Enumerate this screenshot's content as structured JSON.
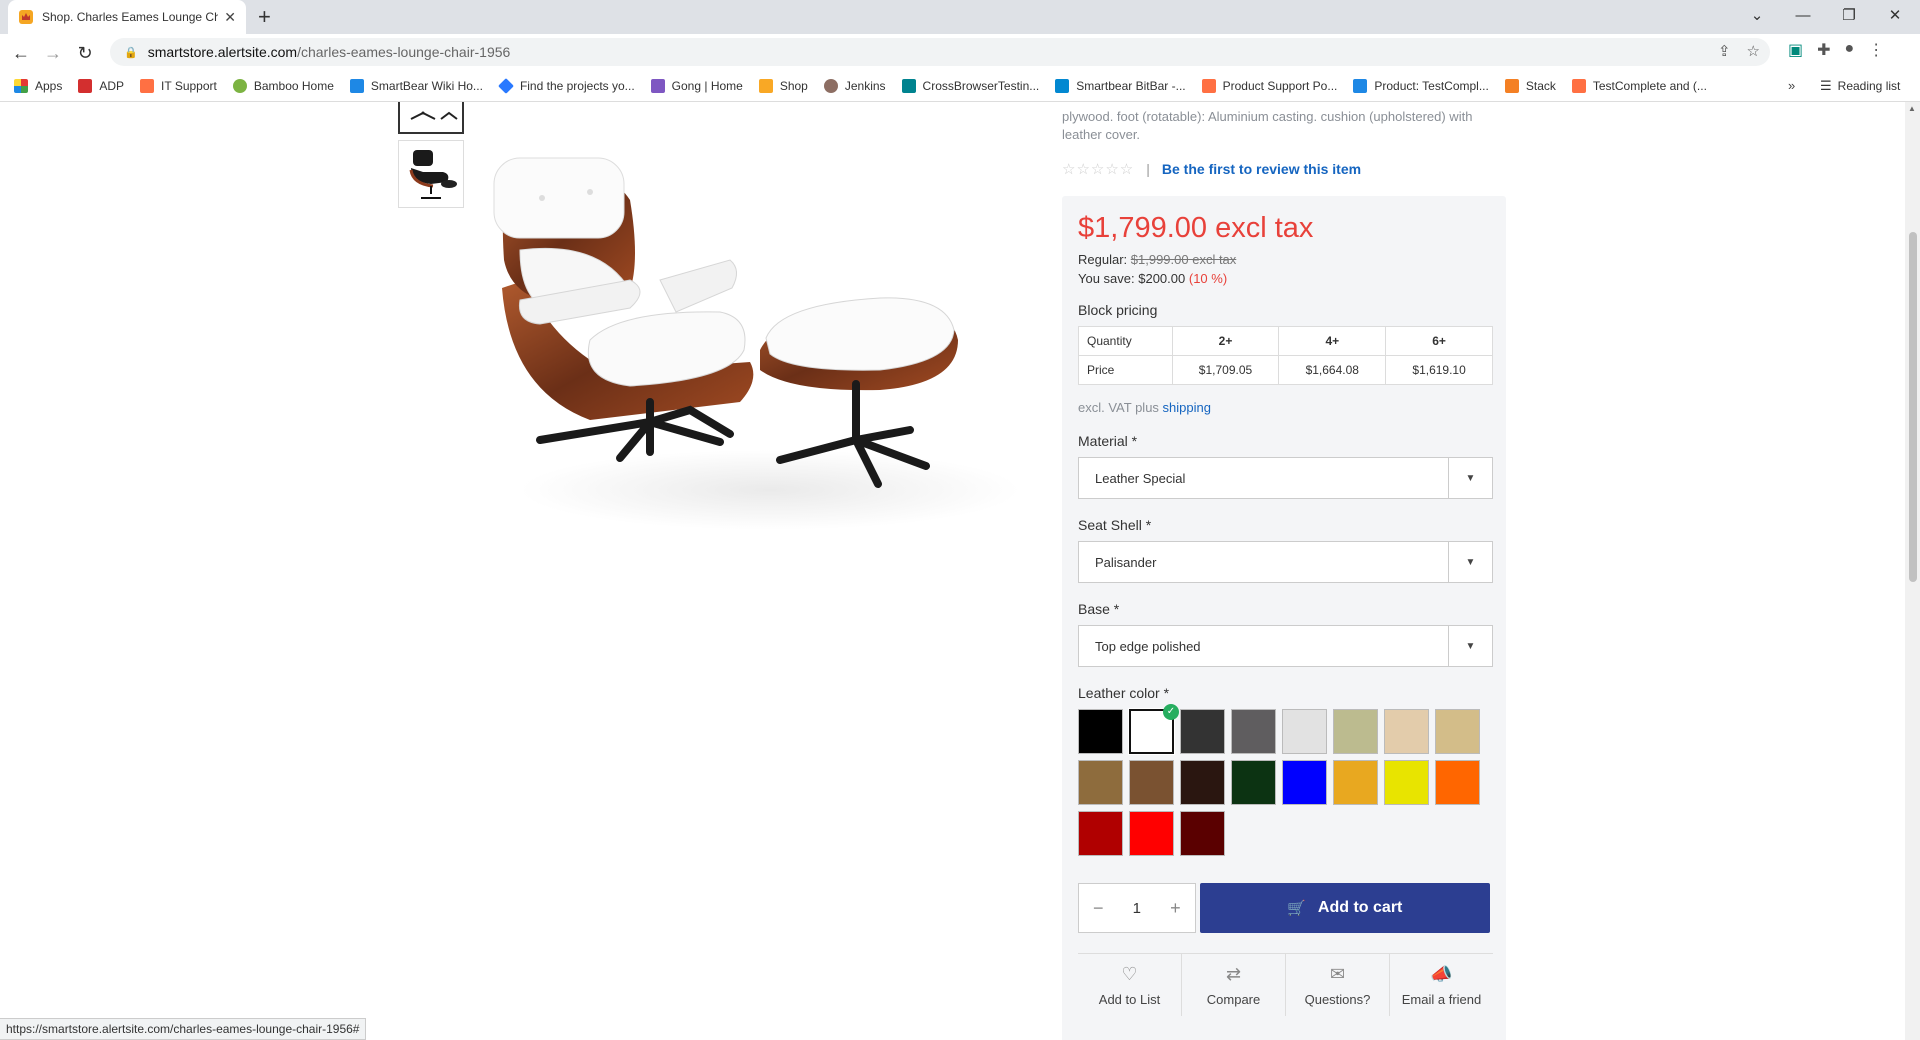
{
  "browser": {
    "tab_title": "Shop. Charles Eames Lounge Chair",
    "url_host": "smartstore.alertsite.com",
    "url_path": "/charles-eames-lounge-chair-1956",
    "bookmarks": [
      {
        "label": "Apps",
        "color": "#e53935"
      },
      {
        "label": "ADP",
        "color": "#d32f2f"
      },
      {
        "label": "IT Support",
        "color": "#ff7043"
      },
      {
        "label": "Bamboo Home",
        "color": "#7cb342"
      },
      {
        "label": "SmartBear Wiki Ho...",
        "color": "#1e88e5"
      },
      {
        "label": "Find the projects yo...",
        "color": "#2979ff"
      },
      {
        "label": "Gong | Home",
        "color": "#7e57c2"
      },
      {
        "label": "Shop",
        "color": "#f9a825"
      },
      {
        "label": "Jenkins",
        "color": "#8d6e63"
      },
      {
        "label": "CrossBrowserTestin...",
        "color": "#00838f"
      },
      {
        "label": "Smartbear BitBar -...",
        "color": "#0288d1"
      },
      {
        "label": "Product Support Po...",
        "color": "#ff7043"
      },
      {
        "label": "Product: TestCompl...",
        "color": "#1e88e5"
      },
      {
        "label": "Stack",
        "color": "#f48024"
      },
      {
        "label": "TestComplete and (...",
        "color": "#ff7043"
      }
    ],
    "more_label": "»",
    "reading_list": "Reading list",
    "status_url": "https://smartstore.alertsite.com/charles-eames-lounge-chair-1956#"
  },
  "product": {
    "description": "plywood. foot (rotatable): Aluminium casting. cushion (upholstered) with leather cover.",
    "stars": "☆☆☆☆☆",
    "review_link": "Be the first to review this item",
    "price": "$1,799.00 excl tax",
    "regular_label": "Regular:",
    "regular_price": "$1,999.00 excl tax",
    "save_label": "You save: $200.00",
    "save_pct": "(10 %)",
    "block_pricing_title": "Block pricing",
    "block_table": {
      "row1_label": "Quantity",
      "quantities": [
        "2+",
        "4+",
        "6+"
      ],
      "row2_label": "Price",
      "prices": [
        "$1,709.05",
        "$1,664.08",
        "$1,619.10"
      ]
    },
    "tax_note": "excl. VAT plus",
    "shipping_link": "shipping",
    "material_label": "Material *",
    "material_value": "Leather Special",
    "seat_shell_label": "Seat Shell *",
    "seat_shell_value": "Palisander",
    "base_label": "Base *",
    "base_value": "Top edge polished",
    "leather_color_label": "Leather color *",
    "leather_colors": [
      "#000000",
      "#ffffff",
      "#333333",
      "#5f5d5f",
      "#e2e2e2",
      "#bcbb8f",
      "#e3ccab",
      "#d3bd89",
      "#8e6c3d",
      "#7a5231",
      "#2a1610",
      "#0c3312",
      "#0000ff",
      "#e8a820",
      "#e8e400",
      "#ff6600",
      "#b00000",
      "#ff0000",
      "#5a0000"
    ],
    "selected_color_index": 1,
    "quantity": "1",
    "add_to_cart": "Add to cart",
    "actions": [
      "Add to List",
      "Compare",
      "Questions?",
      "Email a friend"
    ]
  }
}
